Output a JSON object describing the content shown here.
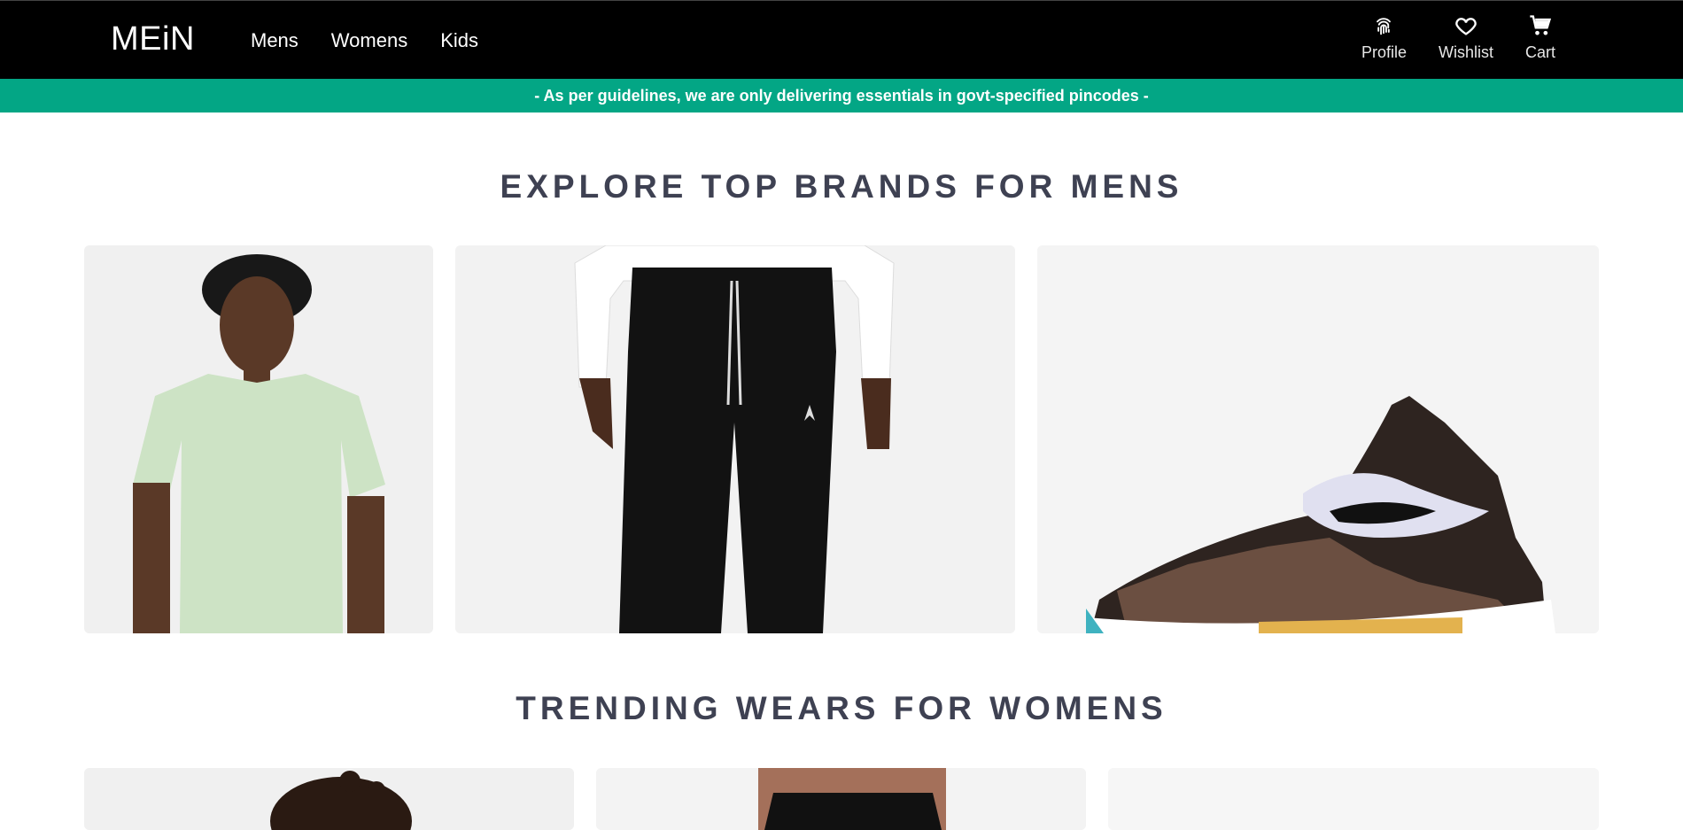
{
  "header": {
    "brand": "MEiN",
    "nav": [
      "Mens",
      "Womens",
      "Kids"
    ],
    "actions": [
      {
        "label": "Profile",
        "icon": "fingerprint-icon"
      },
      {
        "label": "Wishlist",
        "icon": "heart-icon"
      },
      {
        "label": "Cart",
        "icon": "cart-icon"
      }
    ]
  },
  "banner": {
    "text": "- As per guidelines, we are only delivering essentials in govt-specified pincodes -"
  },
  "sections": [
    {
      "title": "EXPLORE TOP BRANDS FOR MENS",
      "cards": [
        "green-tshirt-image",
        "black-joggers-image",
        "sneaker-image"
      ]
    },
    {
      "title": "TRENDING WEARS FOR WOMENS",
      "cards": [
        "curly-hair-model-image",
        "black-top-model-image",
        "blank-product-image"
      ]
    }
  ],
  "colors": {
    "navbar": "#000000",
    "banner": "#03a685",
    "heading": "#3e4152",
    "card_bg": "#f3f3f3"
  }
}
